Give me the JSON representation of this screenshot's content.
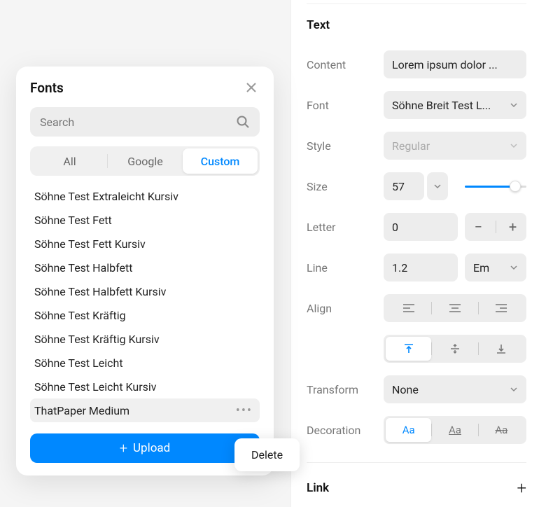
{
  "fonts_panel": {
    "title": "Fonts",
    "search_placeholder": "Search",
    "tabs": {
      "all": "All",
      "google": "Google",
      "custom": "Custom",
      "active": "Custom"
    },
    "items": [
      "Söhne Test Extraleicht Kursiv",
      "Söhne Test Fett",
      "Söhne Test Fett Kursiv",
      "Söhne Test Halbfett",
      "Söhne Test Halbfett Kursiv",
      "Söhne Test Kräftig",
      "Söhne Test Kräftig Kursiv",
      "Söhne Test Leicht",
      "Söhne Test Leicht Kursiv",
      "ThatPaper Medium"
    ],
    "selected_index": 9,
    "upload_label": "Upload",
    "context_menu": {
      "delete": "Delete"
    }
  },
  "text_section": {
    "title": "Text",
    "labels": {
      "content": "Content",
      "font": "Font",
      "style": "Style",
      "size": "Size",
      "letter": "Letter",
      "line": "Line",
      "align": "Align",
      "transform": "Transform",
      "decoration": "Decoration"
    },
    "values": {
      "content": "Lorem ipsum dolor ...",
      "font": "Söhne Breit Test L...",
      "style": "Regular",
      "size": "57",
      "letter": "0",
      "line": "1.2",
      "line_unit": "Em",
      "transform": "None"
    },
    "decoration_sample": "Aa"
  },
  "link_section": {
    "title": "Link"
  }
}
